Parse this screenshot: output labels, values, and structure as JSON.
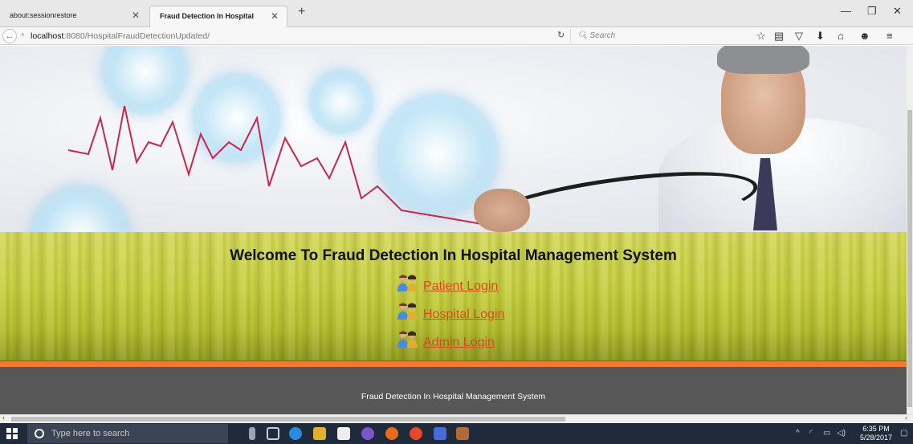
{
  "browser": {
    "tabs": [
      {
        "label": "about:sessionrestore",
        "active": false
      },
      {
        "label": "Fraud Detection In Hospital",
        "active": true
      }
    ],
    "url_host": "localhost",
    "url_rest": ":8080/HospitalFraudDetectionUpdated/",
    "search_placeholder": "Search",
    "icons": [
      "back-icon",
      "site-info-icon",
      "reload-icon",
      "search-icon",
      "bookmark-star-icon",
      "reading-list-icon",
      "pocket-icon",
      "download-icon",
      "home-icon",
      "chat-icon",
      "menu-icon",
      "minimize-icon",
      "restore-icon",
      "close-icon"
    ]
  },
  "page": {
    "welcome_title": "Welcome To Fraud Detection In Hospital Management System",
    "links": {
      "patient": "Patient Login",
      "hospital": "Hospital Login",
      "admin": "Admin Login"
    },
    "footer_text": "Fraud Detection In Hospital Management System",
    "colors": {
      "link": "#d84b1e",
      "welcome_band": "#c6ce3c",
      "orange_band": "#ee7a33",
      "footer": "#575757"
    }
  },
  "taskbar": {
    "search_placeholder": "Type here to search",
    "time": "6:35 PM",
    "date": "5/28/2017"
  }
}
